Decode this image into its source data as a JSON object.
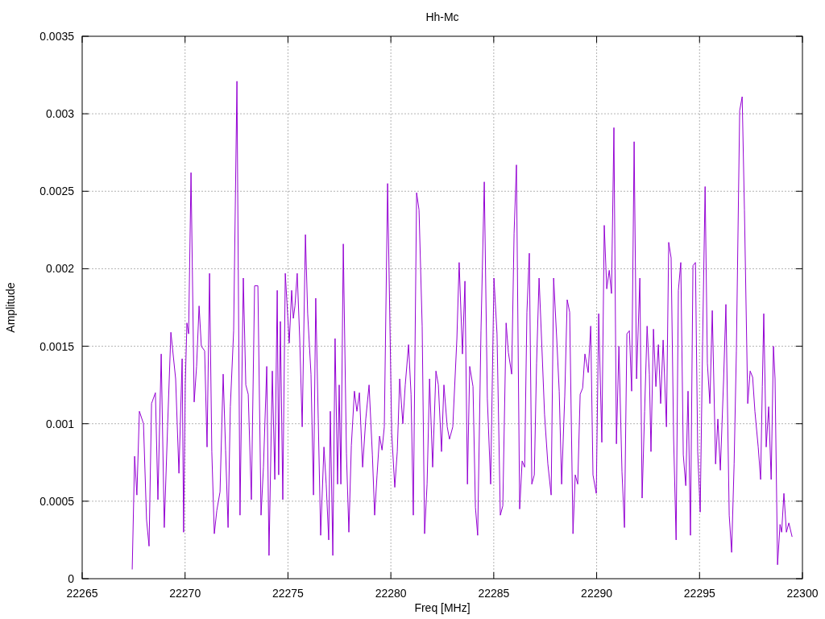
{
  "plot": {
    "chart_data": {
      "type": "line",
      "title": "Hh-Mc",
      "xlabel": "Freq [MHz]",
      "ylabel": "Amplitude",
      "grid": true,
      "xlim": [
        22265,
        22300
      ],
      "ylim": [
        0,
        0.0035
      ],
      "xticks": [
        22265,
        22270,
        22275,
        22280,
        22285,
        22290,
        22295,
        22300
      ],
      "yticks": [
        0,
        0.0005,
        0.001,
        0.0015,
        0.002,
        0.0025,
        0.003,
        0.0035
      ],
      "x": [
        22267.43,
        22267.55,
        22267.66,
        22267.78,
        22267.98,
        22268.13,
        22268.25,
        22268.37,
        22268.56,
        22268.68,
        22268.84,
        22268.99,
        22269.15,
        22269.31,
        22269.54,
        22269.7,
        22269.86,
        22269.93,
        22270.01,
        22270.09,
        22270.17,
        22270.29,
        22270.44,
        22270.56,
        22270.68,
        22270.79,
        22270.95,
        22271.07,
        22271.19,
        22271.3,
        22271.42,
        22271.54,
        22271.7,
        22271.85,
        22271.97,
        22272.09,
        22272.2,
        22272.36,
        22272.52,
        22272.67,
        22272.83,
        22272.95,
        22273.07,
        22273.22,
        22273.38,
        22273.54,
        22273.69,
        22273.81,
        22273.97,
        22274.08,
        22274.24,
        22274.36,
        22274.48,
        22274.55,
        22274.63,
        22274.75,
        22274.87,
        22274.95,
        22275.06,
        22275.18,
        22275.26,
        22275.34,
        22275.45,
        22275.57,
        22275.69,
        22275.85,
        22275.96,
        22276.12,
        22276.24,
        22276.35,
        22276.47,
        22276.59,
        22276.75,
        22276.86,
        22276.98,
        22277.06,
        22277.18,
        22277.29,
        22277.41,
        22277.49,
        22277.57,
        22277.69,
        22277.84,
        22277.96,
        22278.08,
        22278.23,
        22278.35,
        22278.47,
        22278.63,
        22278.78,
        22278.94,
        22279.1,
        22279.21,
        22279.33,
        22279.45,
        22279.57,
        22279.68,
        22279.84,
        22280.04,
        22280.19,
        22280.31,
        22280.43,
        22280.58,
        22280.7,
        22280.86,
        22280.98,
        22281.09,
        22281.25,
        22281.37,
        22281.52,
        22281.64,
        22281.76,
        22281.88,
        22282.03,
        22282.19,
        22282.31,
        22282.46,
        22282.58,
        22282.74,
        22282.85,
        22283.01,
        22283.21,
        22283.32,
        22283.48,
        22283.6,
        22283.72,
        22283.83,
        22283.99,
        22284.11,
        22284.22,
        22284.38,
        22284.54,
        22284.69,
        22284.85,
        22285.01,
        22285.16,
        22285.32,
        22285.44,
        22285.6,
        22285.71,
        22285.87,
        22285.99,
        22286.1,
        22286.26,
        22286.38,
        22286.5,
        22286.61,
        22286.73,
        22286.85,
        22286.97,
        22287.08,
        22287.2,
        22287.36,
        22287.47,
        22287.63,
        22287.79,
        22287.91,
        22288.06,
        22288.18,
        22288.3,
        22288.45,
        22288.57,
        22288.69,
        22288.85,
        22288.96,
        22289.08,
        22289.2,
        22289.32,
        22289.43,
        22289.59,
        22289.71,
        22289.82,
        22289.98,
        22290.1,
        22290.25,
        22290.37,
        22290.49,
        22290.61,
        22290.72,
        22290.84,
        22290.96,
        22291.08,
        22291.23,
        22291.35,
        22291.47,
        22291.59,
        22291.7,
        22291.82,
        22291.94,
        22292.1,
        22292.21,
        22292.33,
        22292.45,
        22292.56,
        22292.64,
        22292.76,
        22292.88,
        22293.0,
        22293.11,
        22293.23,
        22293.39,
        22293.5,
        22293.62,
        22293.74,
        22293.86,
        22293.97,
        22294.09,
        22294.21,
        22294.33,
        22294.44,
        22294.56,
        22294.68,
        22294.8,
        22294.91,
        22295.03,
        22295.15,
        22295.27,
        22295.38,
        22295.5,
        22295.62,
        22295.78,
        22295.89,
        22296.01,
        22296.17,
        22296.28,
        22296.44,
        22296.56,
        22296.68,
        22296.79,
        22296.95,
        22297.07,
        22297.18,
        22297.34,
        22297.46,
        22297.58,
        22297.69,
        22297.85,
        22297.97,
        22298.05,
        22298.12,
        22298.24,
        22298.36,
        22298.48,
        22298.59,
        22298.67,
        22298.79,
        22298.91,
        22298.99,
        22299.1,
        22299.22,
        22299.34,
        22299.5
      ],
      "series": [
        {
          "color": "#9400d3",
          "values": [
            6e-05,
            0.00079,
            0.00054,
            0.00108,
            0.001,
            0.00038,
            0.00021,
            0.00113,
            0.0012,
            0.00051,
            0.00145,
            0.00033,
            0.00098,
            0.00159,
            0.00129,
            0.00068,
            0.00142,
            0.0003,
            0.00126,
            0.00165,
            0.00158,
            0.00262,
            0.00114,
            0.00137,
            0.00176,
            0.0015,
            0.00147,
            0.00085,
            0.00197,
            0.00082,
            0.00029,
            0.00044,
            0.00056,
            0.00132,
            0.00083,
            0.00033,
            0.00111,
            0.0016,
            0.00321,
            0.00041,
            0.00194,
            0.00125,
            0.00119,
            0.00051,
            0.00189,
            0.00189,
            0.00041,
            0.00072,
            0.00137,
            0.00015,
            0.00134,
            0.00064,
            0.00186,
            0.00067,
            0.00166,
            0.00051,
            0.00197,
            0.00178,
            0.00152,
            0.00186,
            0.00168,
            0.00176,
            0.00197,
            0.00155,
            0.00098,
            0.00222,
            0.00171,
            0.00132,
            0.00054,
            0.00181,
            0.00103,
            0.00028,
            0.00085,
            0.00061,
            0.00025,
            0.00108,
            0.00015,
            0.00155,
            0.00061,
            0.00125,
            0.00061,
            0.00216,
            0.00081,
            0.0003,
            0.00086,
            0.00121,
            0.00108,
            0.0012,
            0.00072,
            0.00103,
            0.00125,
            0.0008,
            0.00041,
            0.00067,
            0.00092,
            0.00083,
            0.00098,
            0.00255,
            0.00094,
            0.00059,
            0.00082,
            0.00129,
            0.001,
            0.00125,
            0.00151,
            0.00119,
            0.00041,
            0.00249,
            0.00238,
            0.00163,
            0.00029,
            0.00061,
            0.00129,
            0.00072,
            0.00134,
            0.00125,
            0.00082,
            0.00125,
            0.00098,
            0.0009,
            0.00098,
            0.00155,
            0.00204,
            0.00145,
            0.00192,
            0.00061,
            0.00137,
            0.00124,
            0.00046,
            0.00028,
            0.0016,
            0.00256,
            0.00116,
            0.00061,
            0.00194,
            0.00158,
            0.00041,
            0.00047,
            0.00165,
            0.00146,
            0.00132,
            0.00223,
            0.00267,
            0.00045,
            0.00076,
            0.00072,
            0.00172,
            0.0021,
            0.00061,
            0.00067,
            0.00139,
            0.00194,
            0.00143,
            0.00106,
            0.00074,
            0.00054,
            0.00194,
            0.00155,
            0.00121,
            0.00061,
            0.00118,
            0.0018,
            0.00172,
            0.00029,
            0.00067,
            0.00061,
            0.00119,
            0.00123,
            0.00145,
            0.00133,
            0.00163,
            0.00067,
            0.00055,
            0.00171,
            0.00088,
            0.00228,
            0.00187,
            0.00199,
            0.00184,
            0.00291,
            0.00087,
            0.0015,
            0.00069,
            0.00033,
            0.00158,
            0.0016,
            0.00121,
            0.00282,
            0.00129,
            0.00194,
            0.00052,
            0.00108,
            0.00163,
            0.00132,
            0.00082,
            0.00161,
            0.00124,
            0.00151,
            0.00113,
            0.00154,
            0.00098,
            0.00217,
            0.00207,
            0.00091,
            0.00025,
            0.00186,
            0.00204,
            0.0008,
            0.0006,
            0.00121,
            0.00028,
            0.00202,
            0.00204,
            0.00082,
            0.00043,
            0.00153,
            0.00253,
            0.00139,
            0.00113,
            0.00173,
            0.00074,
            0.00103,
            0.0007,
            0.00129,
            0.00177,
            0.00041,
            0.00017,
            0.00074,
            0.00147,
            0.00302,
            0.00311,
            0.00238,
            0.00113,
            0.00134,
            0.0013,
            0.00108,
            0.00085,
            0.00064,
            0.00124,
            0.00171,
            0.00085,
            0.00111,
            0.00064,
            0.0015,
            0.00129,
            9e-05,
            0.00035,
            0.0003,
            0.00055,
            0.0003,
            0.00036,
            0.00027
          ]
        }
      ]
    }
  }
}
